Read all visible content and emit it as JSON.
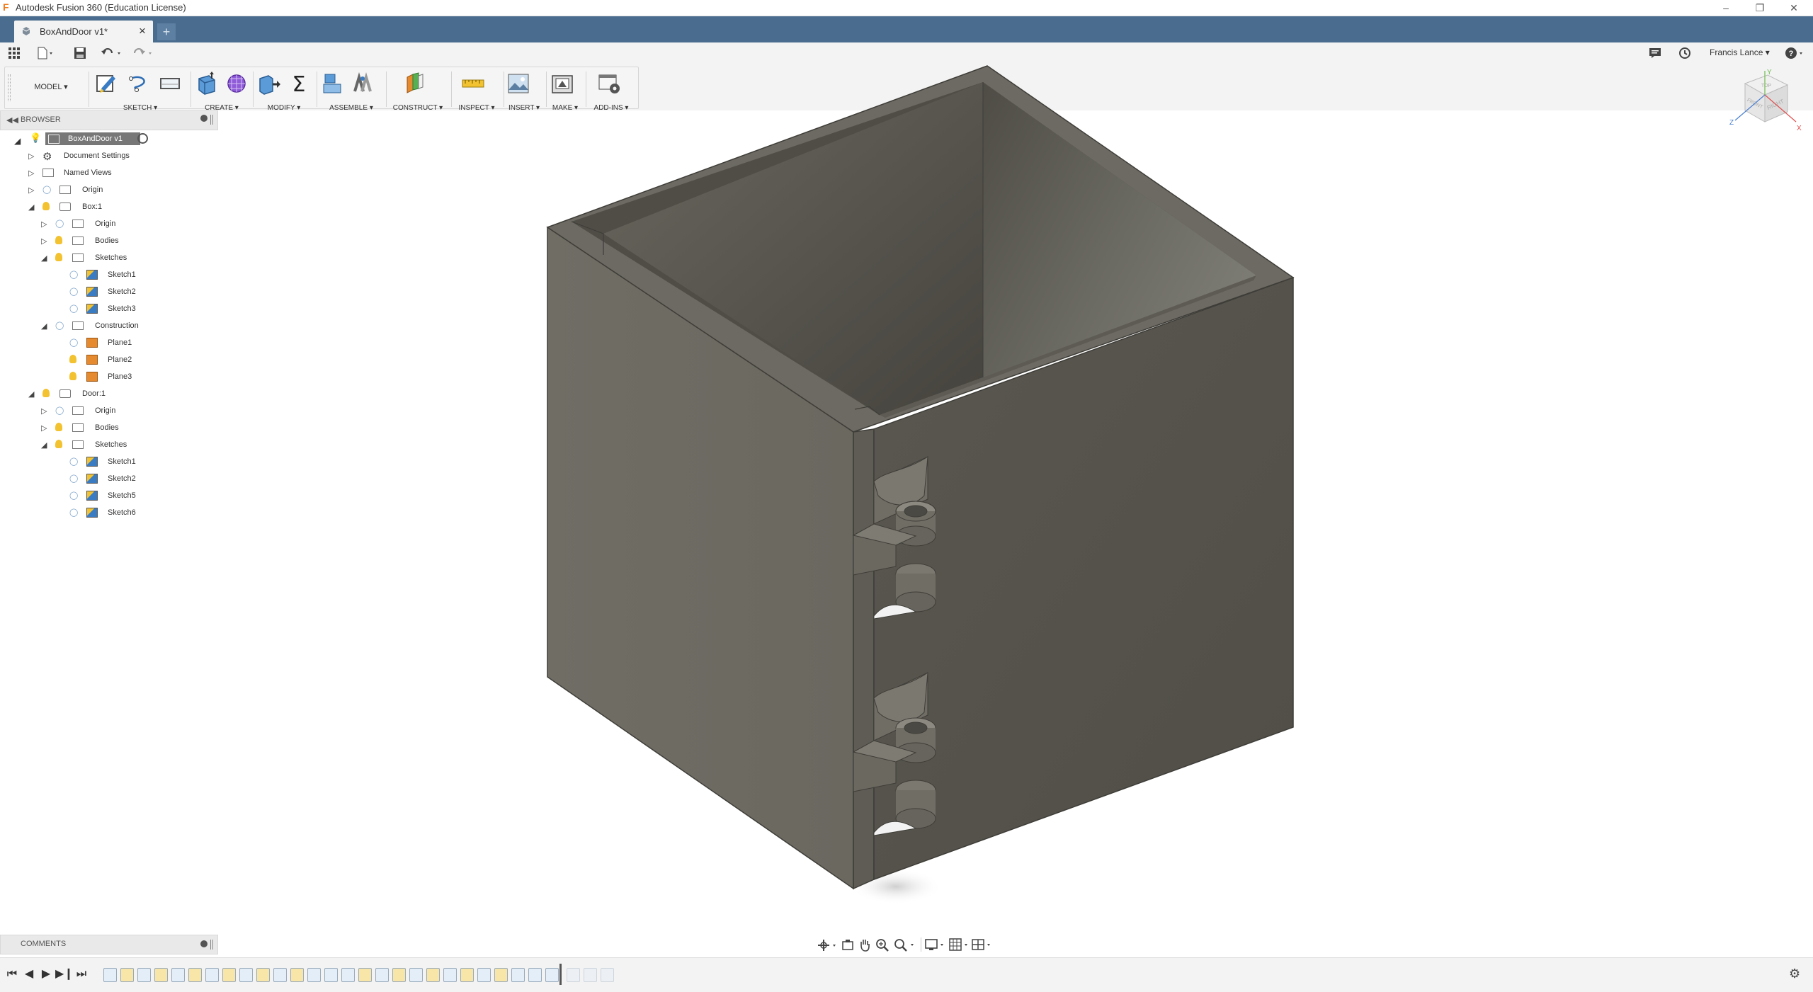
{
  "app": {
    "window_title": "Autodesk Fusion 360 (Education License)",
    "document_tab": "BoxAndDoor v1*",
    "new_tab_symbol": "+",
    "user_name": "Francis Lance"
  },
  "ribbon": {
    "workspace": "MODEL",
    "groups": [
      {
        "label": "SKETCH"
      },
      {
        "label": "CREATE"
      },
      {
        "label": "MODIFY"
      },
      {
        "label": "ASSEMBLE"
      },
      {
        "label": "CONSTRUCT"
      },
      {
        "label": "INSPECT"
      },
      {
        "label": "INSERT"
      },
      {
        "label": "MAKE"
      },
      {
        "label": "ADD-INS"
      }
    ]
  },
  "browser": {
    "title": "BROWSER",
    "root": "BoxAndDoor v1",
    "items": [
      {
        "label": "Document Settings"
      },
      {
        "label": "Named Views"
      },
      {
        "label": "Origin"
      },
      {
        "label": "Box:1"
      },
      {
        "label": "Origin"
      },
      {
        "label": "Bodies"
      },
      {
        "label": "Sketches"
      },
      {
        "label": "Sketch1"
      },
      {
        "label": "Sketch2"
      },
      {
        "label": "Sketch3"
      },
      {
        "label": "Construction"
      },
      {
        "label": "Plane1"
      },
      {
        "label": "Plane2"
      },
      {
        "label": "Plane3"
      },
      {
        "label": "Door:1"
      },
      {
        "label": "Origin"
      },
      {
        "label": "Bodies"
      },
      {
        "label": "Sketches"
      },
      {
        "label": "Sketch1"
      },
      {
        "label": "Sketch2"
      },
      {
        "label": "Sketch5"
      },
      {
        "label": "Sketch6"
      }
    ]
  },
  "viewcube": {
    "face_right": "RIGHT",
    "face_front": "FRONT",
    "face_top": "TOP",
    "axis_x": "X",
    "axis_y": "Y",
    "axis_z": "Z"
  },
  "comments": {
    "title": "COMMENTS"
  },
  "colors": {
    "tab_bar": "#4a6d8f",
    "panel_bg": "#f3f3f3",
    "model_outer": "#6f6d64",
    "model_dark": "#55534b",
    "bulb": "#f2c230"
  }
}
